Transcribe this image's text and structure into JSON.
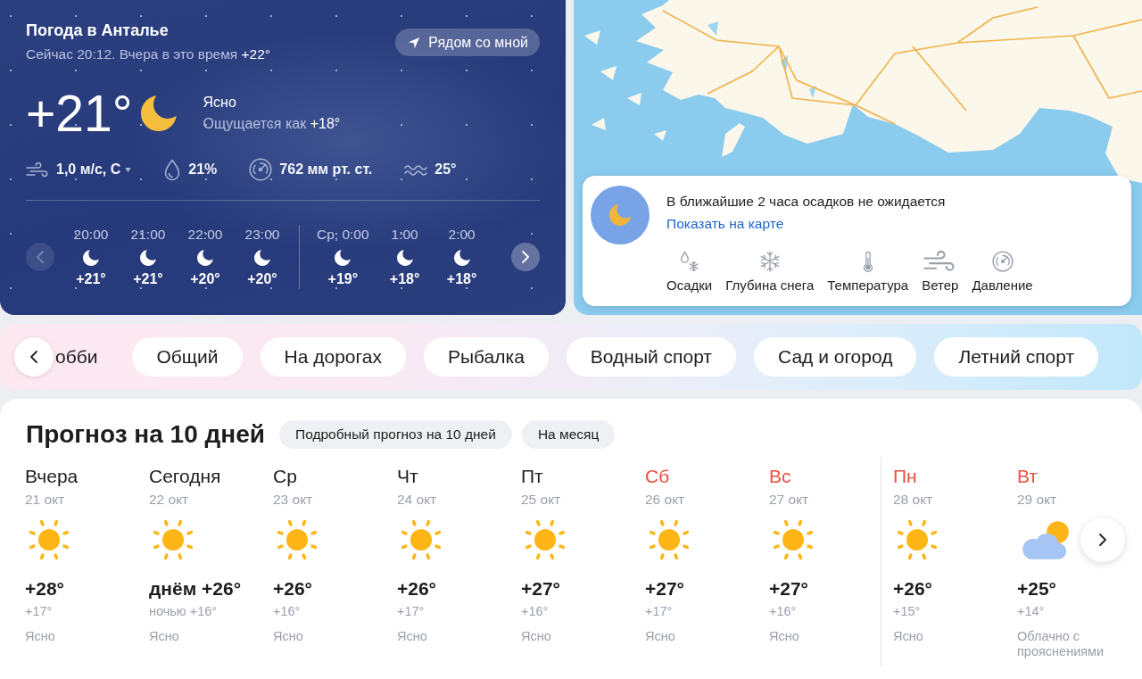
{
  "header": {
    "title": "Погода в Анталье",
    "now_text": "Сейчас 20:12. Вчера в это время",
    "yesterday_temp": "+22°",
    "nearby_button": "Рядом со мной"
  },
  "current": {
    "temperature": "+21°",
    "kind": "clear_night",
    "condition": "Ясно",
    "feels_like_label": "Ощущается как",
    "feels_like": "+18°",
    "details": [
      {
        "kind": "wind",
        "value": "1,0 м/с, С"
      },
      {
        "kind": "humidity",
        "value": "21%"
      },
      {
        "kind": "pressure",
        "value": "762 мм рт. ст."
      },
      {
        "kind": "water_temperature",
        "value": "25°"
      }
    ]
  },
  "hourly": {
    "prev_button": {
      "disabled": true
    },
    "next_button": {
      "disabled": false
    },
    "hours": [
      {
        "time": "20:00",
        "kind": "clear_night",
        "temp": "+21°",
        "new_day": false
      },
      {
        "time": "21:00",
        "kind": "clear_night",
        "temp": "+21°",
        "new_day": false
      },
      {
        "time": "22:00",
        "kind": "clear_night",
        "temp": "+20°",
        "new_day": false
      },
      {
        "time": "23:00",
        "kind": "clear_night",
        "temp": "+20°",
        "new_day": false
      },
      {
        "time": "Ср, 0:00",
        "kind": "clear_night",
        "temp": "+19°",
        "new_day": true
      },
      {
        "time": "1:00",
        "kind": "clear_night",
        "temp": "+18°",
        "new_day": false
      },
      {
        "time": "2:00",
        "kind": "clear_night",
        "temp": "+18°",
        "new_day": false
      }
    ]
  },
  "map": {
    "nowcast": {
      "kind": "clear_night",
      "message": "В ближайшие 2 часа осадков не ожидается",
      "link": "Показать на карте"
    },
    "layers": [
      {
        "kind": "precipitation",
        "label": "Осадки"
      },
      {
        "kind": "snow_depth",
        "label": "Глубина снега"
      },
      {
        "kind": "temperature",
        "label": "Температура"
      },
      {
        "kind": "wind",
        "label": "Ветер"
      },
      {
        "kind": "pressure",
        "label": "Давление"
      }
    ]
  },
  "categories": {
    "partial_label": "обби",
    "items": [
      "Общий",
      "На дорогах",
      "Рыбалка",
      "Водный спорт",
      "Сад и огород",
      "Летний спорт"
    ]
  },
  "forecast": {
    "title": "Прогноз на 10 дней",
    "links": [
      "Подробный прогноз на 10 дней",
      "На месяц"
    ],
    "days": [
      {
        "name": "Вчера",
        "date": "21 окт",
        "kind": "clear",
        "high": "+28°",
        "low": "+17°",
        "condition": "Ясно",
        "day_off": false,
        "week_start": false
      },
      {
        "name": "Сегодня",
        "date": "22 окт",
        "kind": "clear",
        "high": "днём +26°",
        "low": "ночью +16°",
        "condition": "Ясно",
        "day_off": false,
        "week_start": false
      },
      {
        "name": "Ср",
        "date": "23 окт",
        "kind": "clear",
        "high": "+26°",
        "low": "+16°",
        "condition": "Ясно",
        "day_off": false,
        "week_start": false
      },
      {
        "name": "Чт",
        "date": "24 окт",
        "kind": "clear",
        "high": "+26°",
        "low": "+17°",
        "condition": "Ясно",
        "day_off": false,
        "week_start": false
      },
      {
        "name": "Пт",
        "date": "25 окт",
        "kind": "clear",
        "high": "+27°",
        "low": "+16°",
        "condition": "Ясно",
        "day_off": false,
        "week_start": false
      },
      {
        "name": "Сб",
        "date": "26 окт",
        "kind": "clear",
        "high": "+27°",
        "low": "+17°",
        "condition": "Ясно",
        "day_off": true,
        "week_start": false
      },
      {
        "name": "Вс",
        "date": "27 окт",
        "kind": "clear",
        "high": "+27°",
        "low": "+16°",
        "condition": "Ясно",
        "day_off": true,
        "week_start": false
      },
      {
        "name": "Пн",
        "date": "28 окт",
        "kind": "clear",
        "high": "+26°",
        "low": "+15°",
        "condition": "Ясно",
        "day_off": true,
        "week_start": true
      },
      {
        "name": "Вт",
        "date": "29 окт",
        "kind": "partly_cloudy",
        "high": "+25°",
        "low": "+14°",
        "condition": "Облачно с прояснениями",
        "day_off": true,
        "week_start": false
      }
    ]
  }
}
